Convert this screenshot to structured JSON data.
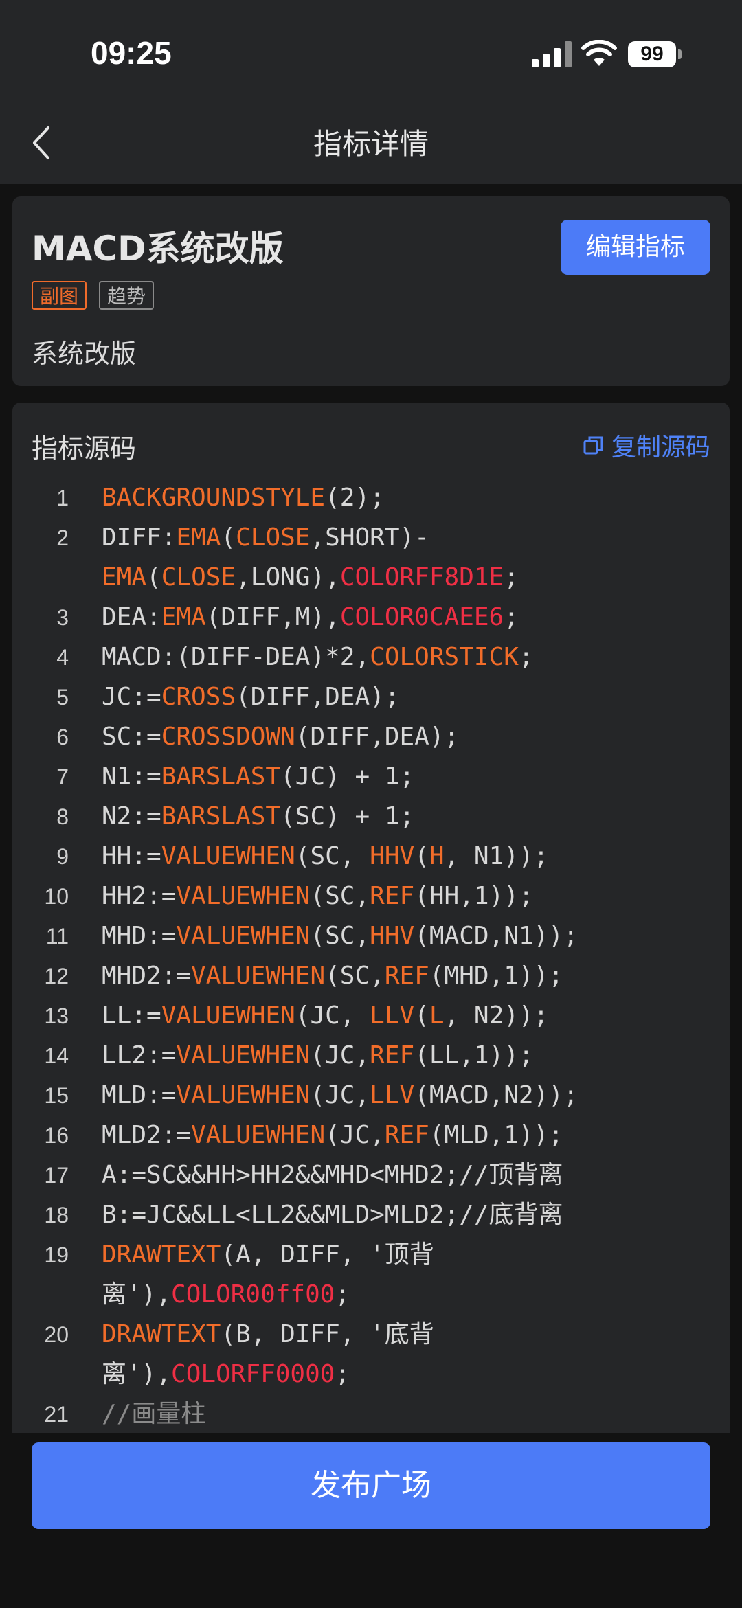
{
  "status_bar": {
    "time": "09:25",
    "battery": "99"
  },
  "nav": {
    "title": "指标详情"
  },
  "indicator": {
    "name": "MACD系统改版",
    "edit_label": "编辑指标",
    "tags": [
      "副图",
      "趋势"
    ],
    "description": "系统改版"
  },
  "source": {
    "title": "指标源码",
    "copy_label": "复制源码",
    "lines": [
      {
        "n": "1",
        "parts": [
          [
            "kw",
            "BACKGROUNDSTYLE"
          ],
          [
            "t",
            "(2);"
          ]
        ]
      },
      {
        "n": "2",
        "parts": [
          [
            "t",
            "DIFF:"
          ],
          [
            "kw",
            "EMA"
          ],
          [
            "t",
            "("
          ],
          [
            "kw",
            "CLOSE"
          ],
          [
            "t",
            ",SHORT)-\n"
          ],
          [
            "kw",
            "EMA"
          ],
          [
            "t",
            "("
          ],
          [
            "kw",
            "CLOSE"
          ],
          [
            "t",
            ",LONG),"
          ],
          [
            "cl",
            "COLORFF8D1E"
          ],
          [
            "t",
            ";"
          ]
        ]
      },
      {
        "n": "3",
        "parts": [
          [
            "t",
            "DEA:"
          ],
          [
            "kw",
            "EMA"
          ],
          [
            "t",
            "(DIFF,M),"
          ],
          [
            "cl",
            "COLOR0CAEE6"
          ],
          [
            "t",
            ";"
          ]
        ]
      },
      {
        "n": "4",
        "parts": [
          [
            "t",
            "MACD:(DIFF-DEA)*2,"
          ],
          [
            "kw",
            "COLORSTICK"
          ],
          [
            "t",
            ";"
          ]
        ]
      },
      {
        "n": "5",
        "parts": [
          [
            "t",
            "JC:="
          ],
          [
            "kw",
            "CROSS"
          ],
          [
            "t",
            "(DIFF,DEA);"
          ]
        ]
      },
      {
        "n": "6",
        "parts": [
          [
            "t",
            "SC:="
          ],
          [
            "kw",
            "CROSSDOWN"
          ],
          [
            "t",
            "(DIFF,DEA);"
          ]
        ]
      },
      {
        "n": "7",
        "parts": [
          [
            "t",
            "N1:="
          ],
          [
            "kw",
            "BARSLAST"
          ],
          [
            "t",
            "(JC) + 1;"
          ]
        ]
      },
      {
        "n": "8",
        "parts": [
          [
            "t",
            "N2:="
          ],
          [
            "kw",
            "BARSLAST"
          ],
          [
            "t",
            "(SC) + 1;"
          ]
        ]
      },
      {
        "n": "9",
        "parts": [
          [
            "t",
            "HH:="
          ],
          [
            "kw",
            "VALUEWHEN"
          ],
          [
            "t",
            "(SC, "
          ],
          [
            "kw",
            "HHV"
          ],
          [
            "t",
            "("
          ],
          [
            "kw",
            "H"
          ],
          [
            "t",
            ", N1));"
          ]
        ]
      },
      {
        "n": "10",
        "parts": [
          [
            "t",
            "HH2:="
          ],
          [
            "kw",
            "VALUEWHEN"
          ],
          [
            "t",
            "(SC,"
          ],
          [
            "kw",
            "REF"
          ],
          [
            "t",
            "(HH,1));"
          ]
        ]
      },
      {
        "n": "11",
        "parts": [
          [
            "t",
            "MHD:="
          ],
          [
            "kw",
            "VALUEWHEN"
          ],
          [
            "t",
            "(SC,"
          ],
          [
            "kw",
            "HHV"
          ],
          [
            "t",
            "(MACD,N1));"
          ]
        ]
      },
      {
        "n": "12",
        "parts": [
          [
            "t",
            "MHD2:="
          ],
          [
            "kw",
            "VALUEWHEN"
          ],
          [
            "t",
            "(SC,"
          ],
          [
            "kw",
            "REF"
          ],
          [
            "t",
            "(MHD,1));"
          ]
        ]
      },
      {
        "n": "13",
        "parts": [
          [
            "t",
            "LL:="
          ],
          [
            "kw",
            "VALUEWHEN"
          ],
          [
            "t",
            "(JC, "
          ],
          [
            "kw",
            "LLV"
          ],
          [
            "t",
            "("
          ],
          [
            "kw",
            "L"
          ],
          [
            "t",
            ", N2));"
          ]
        ]
      },
      {
        "n": "14",
        "parts": [
          [
            "t",
            "LL2:="
          ],
          [
            "kw",
            "VALUEWHEN"
          ],
          [
            "t",
            "(JC,"
          ],
          [
            "kw",
            "REF"
          ],
          [
            "t",
            "(LL,1));"
          ]
        ]
      },
      {
        "n": "15",
        "parts": [
          [
            "t",
            "MLD:="
          ],
          [
            "kw",
            "VALUEWHEN"
          ],
          [
            "t",
            "(JC,"
          ],
          [
            "kw",
            "LLV"
          ],
          [
            "t",
            "(MACD,N2));"
          ]
        ]
      },
      {
        "n": "16",
        "parts": [
          [
            "t",
            "MLD2:="
          ],
          [
            "kw",
            "VALUEWHEN"
          ],
          [
            "t",
            "(JC,"
          ],
          [
            "kw",
            "REF"
          ],
          [
            "t",
            "(MLD,1));"
          ]
        ]
      },
      {
        "n": "17",
        "parts": [
          [
            "t",
            "A:=SC&&HH>HH2&&MHD<MHD2;//顶背离"
          ]
        ]
      },
      {
        "n": "18",
        "parts": [
          [
            "t",
            "B:=JC&&LL<LL2&&MLD>MLD2;//底背离"
          ]
        ]
      },
      {
        "n": "19",
        "parts": [
          [
            "kw",
            "DRAWTEXT"
          ],
          [
            "t",
            "(A, DIFF, '顶背\n离'),"
          ],
          [
            "cl",
            "COLOR00ff00"
          ],
          [
            "t",
            ";"
          ]
        ]
      },
      {
        "n": "20",
        "parts": [
          [
            "kw",
            "DRAWTEXT"
          ],
          [
            "t",
            "(B, DIFF, '底背\n离'),"
          ],
          [
            "cl",
            "COLORFF0000"
          ],
          [
            "t",
            ";"
          ]
        ]
      },
      {
        "n": "21",
        "parts": [
          [
            "cm",
            "//画量柱"
          ]
        ]
      }
    ]
  },
  "publish_label": "发布广场",
  "colors": {
    "accent": "#4c7bf7",
    "keyword": "#f26d2a",
    "color_const": "#ef2f45",
    "tag_primary": "#f06b2b"
  }
}
